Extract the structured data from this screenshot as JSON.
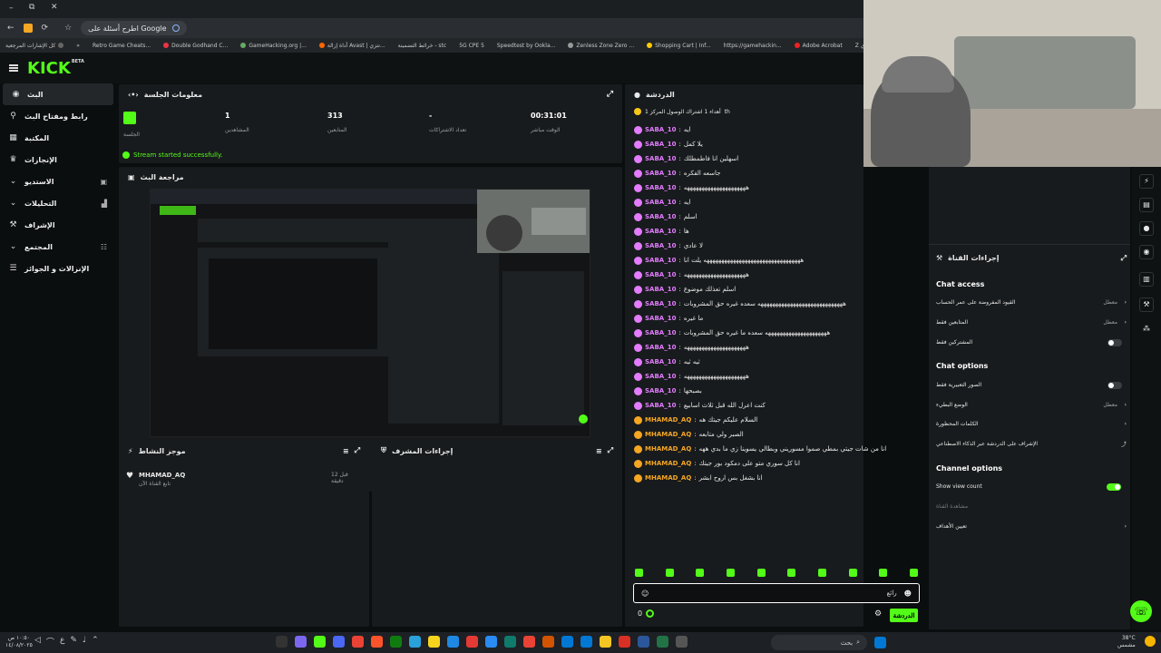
{
  "browser": {
    "tab_title": "اطرح أسئلة على Google",
    "bookmarks": [
      "كل الإشارات المرجعية",
      "Retro Game Cheats...",
      "Double Godhand C...",
      "GameHacking.org |...",
      "أداة إزالة Avast | تنزي...",
      "خرائط التضمينة - stc",
      "5G CPE 5",
      "Speedtest by Ookla...",
      "Zenless Zone Zero ...",
      "Shopping Cart | Inf...",
      "https://gamehackin...",
      "Adobe Acrobat",
      "Z سيدي"
    ]
  },
  "app": {
    "logo": "KICK",
    "logo_sup": "BETA",
    "sidebar": [
      {
        "label": "البث",
        "icon": "broadcast-icon",
        "active": true
      },
      {
        "label": "رابط ومفتاح البث",
        "icon": "link-icon"
      },
      {
        "label": "المكتبة",
        "icon": "library-icon"
      },
      {
        "label": "الإنجازات",
        "icon": "trophy-icon"
      },
      {
        "label": "الاستديو",
        "icon": "studio-icon",
        "chevron": true
      },
      {
        "label": "التحليلات",
        "icon": "analytics-icon",
        "chevron": true
      },
      {
        "label": "الإشراف",
        "icon": "moderation-icon"
      },
      {
        "label": "المجتمع",
        "icon": "community-icon",
        "chevron": true
      },
      {
        "label": "الإنزالات و الجوائز",
        "icon": "drops-icon"
      }
    ],
    "session": {
      "title": "معلومات الجلسة",
      "stats": [
        {
          "value": "",
          "label": "الجلسة"
        },
        {
          "value": "1",
          "label": "المشاهدين"
        },
        {
          "value": "313",
          "label": "المتابعين"
        },
        {
          "value": "-",
          "label": "تعداد الاشتراكات"
        },
        {
          "value": "00:31:01",
          "label": "الوقت مباشر"
        }
      ],
      "status": "Stream started successfully."
    },
    "preview": {
      "title": "مراجعة البث"
    },
    "activity": {
      "title": "موجز النشاط",
      "items": [
        {
          "user": "MHAMAD_AQ",
          "text": "تابع القناة الآن",
          "time": "قبل 12 دقيقة"
        }
      ]
    },
    "mod_actions": {
      "title": "إجراءات المشرف"
    },
    "chat": {
      "title": "الدردشة",
      "pinned": "أهداء 1 اشتراك الوصول المركز 1",
      "pinned_suffix": "th",
      "messages": [
        {
          "user": "SABA_10",
          "text": "ايه",
          "color": "#e37cff"
        },
        {
          "user": "SABA_10",
          "text": "يلا كمل",
          "color": "#e37cff"
        },
        {
          "user": "SABA_10",
          "text": "اسهلين انا فاطمطلك",
          "color": "#e37cff"
        },
        {
          "user": "SABA_10",
          "text": "جاسعه الفكره",
          "color": "#e37cff"
        },
        {
          "user": "SABA_10",
          "text": "هههههههههههههههههههههه",
          "color": "#e37cff"
        },
        {
          "user": "SABA_10",
          "text": "ايه",
          "color": "#e37cff"
        },
        {
          "user": "SABA_10",
          "text": "اسلم",
          "color": "#e37cff"
        },
        {
          "user": "SABA_10",
          "text": "ها",
          "color": "#e37cff"
        },
        {
          "user": "SABA_10",
          "text": "لا عادي",
          "color": "#e37cff"
        },
        {
          "user": "SABA_10",
          "text": "هههههههههههههههههههههههههههههههههه يلت انا",
          "color": "#e37cff"
        },
        {
          "user": "SABA_10",
          "text": "هههههههههههههههههههههه",
          "color": "#e37cff"
        },
        {
          "user": "SABA_10",
          "text": "اسلم تعذلك موضوع",
          "color": "#e37cff"
        },
        {
          "user": "SABA_10",
          "text": "هههههههههههههههههههههههههههههه سعده غيره حق المشروبات",
          "color": "#e37cff"
        },
        {
          "user": "SABA_10",
          "text": "ما غيره",
          "color": "#e37cff"
        },
        {
          "user": "SABA_10",
          "text": "هههههههههههههههههههههه سعده ما غيره حق المشروبات",
          "color": "#e37cff"
        },
        {
          "user": "SABA_10",
          "text": "هههههههههههههههههههههه",
          "color": "#e37cff"
        },
        {
          "user": "SABA_10",
          "text": "ثيه ثيه",
          "color": "#e37cff"
        },
        {
          "user": "SABA_10",
          "text": "هههههههههههههههههههههه",
          "color": "#e37cff"
        },
        {
          "user": "SABA_10",
          "text": "بصبحها",
          "color": "#e37cff"
        },
        {
          "user": "SABA_10",
          "text": "كنت اعرل الله قبل ثلاث اسابيع",
          "color": "#e37cff"
        },
        {
          "user": "MHAMAD_AQ",
          "text": "السلام عليكم جيتك هه",
          "color": "#f5a623"
        },
        {
          "user": "MHAMAD_AQ",
          "text": "الصبر ولي متابعه",
          "color": "#f5a623"
        },
        {
          "user": "MHAMAD_AQ",
          "text": "انا من شات جيتي بمطي صموا مسوريني وبطالي يسوينا زي ما بدي ههه",
          "color": "#f5a623"
        },
        {
          "user": "MHAMAD_AQ",
          "text": "انا كل سوري متو على دمكود بور جيتك",
          "color": "#f5a623"
        },
        {
          "user": "MHAMAD_AQ",
          "text": "انا بشغل بس اروح ابشر",
          "color": "#f5a623"
        }
      ],
      "input_placeholder": "رائع",
      "count": "0",
      "send_label": "الدردشة"
    },
    "channel_actions": {
      "title": "إجراءات القناة",
      "chat_access": "Chat access",
      "chat_access_rows": [
        {
          "label": "القيود المفروضة على عمر الحساب",
          "right": "معطل",
          "type": "chevron"
        },
        {
          "label": "المتابعين فقط",
          "right": "معطل",
          "type": "chevron"
        },
        {
          "label": "المشتركين فقط",
          "type": "toggle",
          "on": false
        }
      ],
      "chat_options": "Chat options",
      "chat_options_rows": [
        {
          "label": "الصور التعبيرية فقط",
          "type": "toggle",
          "on": false
        },
        {
          "label": "الوضع البطيء",
          "right": "معطل",
          "type": "chevron"
        },
        {
          "label": "الكلمات المحظورة",
          "type": "chevron"
        },
        {
          "label": "الإشراف على الدردشة عبر الذكاء الاصطناعي",
          "type": "external"
        }
      ],
      "channel_options": "Channel options",
      "channel_options_rows": [
        {
          "label": "Show view count",
          "type": "toggle",
          "on": true
        },
        {
          "label": "مشاهدة القناة",
          "type": "muted"
        },
        {
          "label": "تعيين الأهداف",
          "type": "chevron"
        }
      ]
    }
  },
  "taskbar": {
    "search": "بحث",
    "weather": "38°C",
    "weather_desc": "مشمس",
    "clock_time": "١٠:٥٠ ص",
    "clock_date": "١٤/٠٨/٢٠٢٥"
  },
  "colors": {
    "accent": "#53fc18",
    "panel": "#181b1d",
    "bg": "#0b0e0f"
  }
}
